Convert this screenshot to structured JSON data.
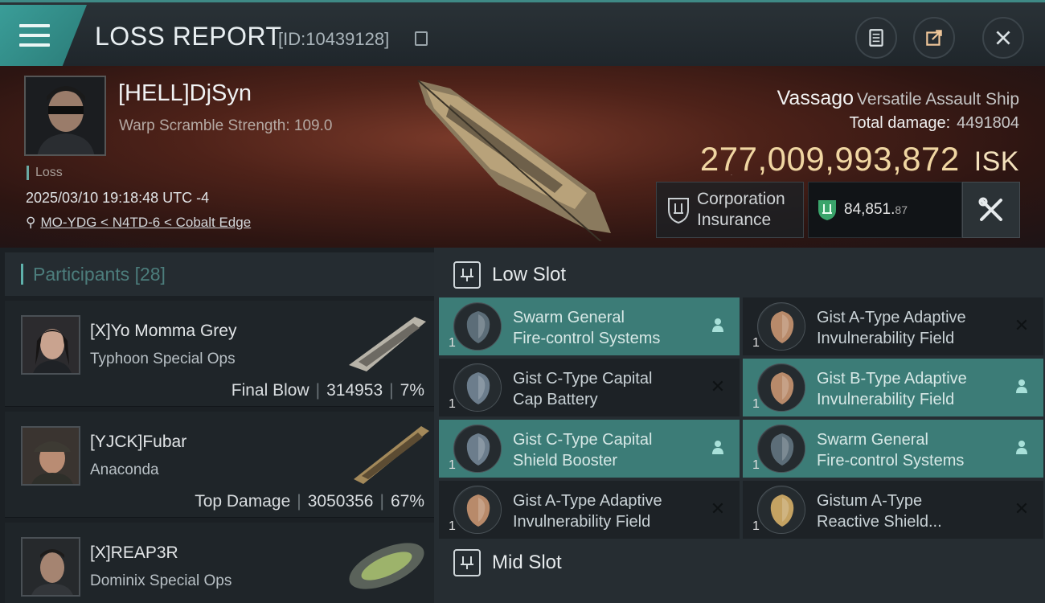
{
  "header": {
    "title": "LOSS REPORT",
    "report_id": "[ID:10439128]",
    "icons": [
      "menu-icon",
      "clipboard-icon",
      "share-icon",
      "close-icon"
    ]
  },
  "victim": {
    "pilot": "[HELL]DjSyn",
    "warp_scramble": "Warp Scramble Strength: 109.0",
    "status": "Loss",
    "datetime": "2025/03/10 19:18:48 UTC -4",
    "location": "MO-YDG < N4TD-6 < Cobalt Edge",
    "ship_name": "Vassago",
    "ship_class": "Versatile Assault Ship",
    "total_damage_label": "Total damage:",
    "total_damage": "4491804",
    "isk_value": "277,009,993,872",
    "isk_unit": "ISK",
    "corp_insurance_line1": "Corporation",
    "corp_insurance_line2": "Insurance",
    "insurance_int": "84,851.",
    "insurance_dec": "87"
  },
  "participants": {
    "label": "Participants",
    "count": "[28]",
    "rows": [
      {
        "name": "[X]Yo Momma Grey",
        "ship": "Typhoon Special Ops",
        "role": "Final Blow",
        "damage": "314953",
        "pct": "7%"
      },
      {
        "name": "[YJCK]Fubar",
        "ship": "Anaconda",
        "role": "Top Damage",
        "damage": "3050356",
        "pct": "67%"
      },
      {
        "name": "[X]REAP3R",
        "ship": "Dominix Special Ops",
        "role": "",
        "damage": "",
        "pct": ""
      }
    ]
  },
  "slots": {
    "low_label": "Low Slot",
    "mid_label": "Mid Slot",
    "modules": [
      {
        "l1": "Swarm General",
        "l2": "Fire-control Systems",
        "qty": "1",
        "flag": "user"
      },
      {
        "l1": "Gist A-Type Adaptive",
        "l2": "Invulnerability Field",
        "qty": "1",
        "flag": "destroyed"
      },
      {
        "l1": "Gist C-Type Capital",
        "l2": "Cap Battery",
        "qty": "1",
        "flag": "destroyed"
      },
      {
        "l1": "Gist B-Type Adaptive",
        "l2": "Invulnerability Field",
        "qty": "1",
        "flag": "user"
      },
      {
        "l1": "Gist C-Type Capital",
        "l2": "Shield Booster",
        "qty": "1",
        "flag": "user"
      },
      {
        "l1": "Swarm General",
        "l2": "Fire-control Systems",
        "qty": "1",
        "flag": "user"
      },
      {
        "l1": "Gist A-Type Adaptive",
        "l2": "Invulnerability Field",
        "qty": "1",
        "flag": "destroyed"
      },
      {
        "l1": "Gistum A-Type",
        "l2": "Reactive Shield...",
        "qty": "1",
        "flag": "destroyed"
      }
    ]
  },
  "colors": {
    "accent": "#3c7c77",
    "isk": "#f0d6a2",
    "header_teal": "#3a9d98"
  }
}
